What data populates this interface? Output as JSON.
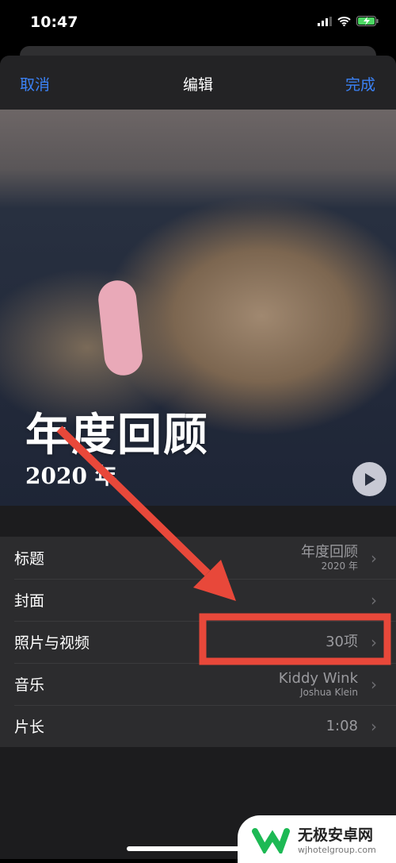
{
  "status": {
    "time": "10:47"
  },
  "nav": {
    "cancel": "取消",
    "title": "编辑",
    "done": "完成"
  },
  "cover": {
    "title": "年度回顾",
    "subtitle": "2020 年"
  },
  "rows": [
    {
      "label": "标题",
      "value": "年度回顾",
      "sub": "2020 年"
    },
    {
      "label": "封面",
      "value": "",
      "sub": ""
    },
    {
      "label": "照片与视频",
      "value": "30项",
      "sub": ""
    },
    {
      "label": "音乐",
      "value": "Kiddy Wink",
      "sub": "Joshua Klein"
    },
    {
      "label": "片长",
      "value": "1:08",
      "sub": ""
    }
  ],
  "watermark": {
    "name": "无极安卓网",
    "url": "wjhotelgroup.com"
  },
  "colors": {
    "accent": "#3b82f6",
    "annotation": "#e8483a"
  }
}
